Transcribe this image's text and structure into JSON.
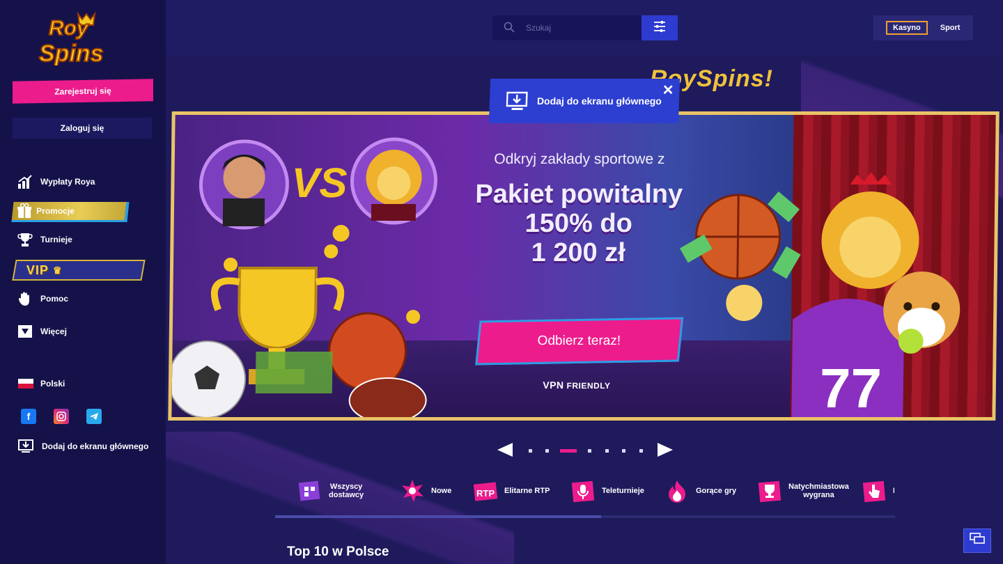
{
  "brand": {
    "logo_text_top": "Roy",
    "logo_text_bottom": "Spins"
  },
  "sidebar": {
    "register_label": "Zarejestruj się",
    "login_label": "Zaloguj się",
    "items": [
      {
        "label": "Wypłaty Roya",
        "icon": "chart-icon"
      },
      {
        "label": "Promocje",
        "icon": "gift-icon"
      },
      {
        "label": "Turnieje",
        "icon": "trophy-icon"
      },
      {
        "label": "VIP",
        "icon": "crown-icon"
      },
      {
        "label": "Pomoc",
        "icon": "hand-icon"
      },
      {
        "label": "Więcej",
        "icon": "chevron-down-icon"
      }
    ],
    "language": "Polski",
    "socials": [
      "facebook-icon",
      "instagram-icon",
      "telegram-icon"
    ],
    "add_home_label": "Dodaj do ekranu głównego"
  },
  "header": {
    "search": {
      "placeholder": "Szukaj"
    },
    "modes": {
      "active": "Kasyno",
      "inactive": "Sport"
    }
  },
  "banner": {
    "welcome_title": "RoySpins!",
    "subtitle": "Odkryj zakłady sportowe z",
    "headline_1": "Pakiet powitalny",
    "headline_2": "150% do",
    "headline_3": "1 200 zł",
    "cta_label": "Odbierz teraz!",
    "vpn_bold": "VPN",
    "vpn_rest": "FRIENDLY",
    "vs_text": "VS",
    "jersey_number": "77"
  },
  "popup": {
    "label": "Dodaj do ekranu głównego",
    "close": "✕"
  },
  "carousel": {
    "slides": 8,
    "active_index": 2
  },
  "categories": [
    {
      "label": "Wszyscy\ndostawcy",
      "icon": "providers-icon"
    },
    {
      "label": "Nowe",
      "icon": "new-burst-icon"
    },
    {
      "label": "Elitarne RTP",
      "icon": "rtp-icon"
    },
    {
      "label": "Teleturnieje",
      "icon": "microphone-icon"
    },
    {
      "label": "Gorące gry",
      "icon": "fire-icon"
    },
    {
      "label": "Natychmiastowa\nwygrana",
      "icon": "trophy-icon"
    },
    {
      "label": "P",
      "icon": "hand-pointer-icon"
    }
  ],
  "section_title": "Top 10 w Polsce",
  "colors": {
    "bg": "#1e1a5c",
    "sidebar": "#15124a",
    "pink": "#ec1c8c",
    "blue": "#2e3bd0",
    "gold": "#e9c468"
  }
}
